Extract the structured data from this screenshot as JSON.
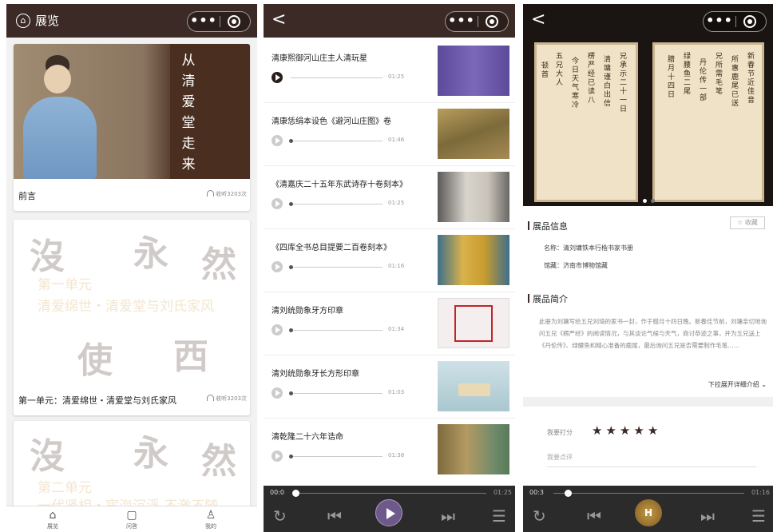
{
  "panel1": {
    "title": "展览",
    "home_icon": "⌂",
    "intro": {
      "poem": [
        "从",
        "清",
        "爱",
        "堂",
        "走",
        "来"
      ],
      "title": "前言",
      "plays": "收听3203次"
    },
    "unit1": {
      "line1": "第一单元",
      "line2": "清爱绵世・清爱堂与刘氏家风",
      "title": "第一单元：清爱绵世・清爱堂与刘氏家风",
      "plays": "收听3203次"
    },
    "unit2": {
      "line1": "第二单元",
      "line2": "一代贤相・宦海沉浮 不激不随"
    },
    "tabs": [
      {
        "icon": "⌂",
        "label": "展览"
      },
      {
        "icon": "▢",
        "label": "问答"
      },
      {
        "icon": "♙",
        "label": "我的"
      }
    ]
  },
  "panel2": {
    "back": "<",
    "items": [
      {
        "title": "清康熙御河山庄主人清玩星",
        "duration": "01:25",
        "playing": true
      },
      {
        "title": "清康恁绢本设色《避河山庄图》卷",
        "duration": "01:46",
        "playing": false
      },
      {
        "title": "《清嘉庆二十五年东武诗存十卷刻本》",
        "duration": "01:25",
        "playing": false
      },
      {
        "title": "《四库全书总目提要二百卷刻本》",
        "duration": "01:16",
        "playing": false
      },
      {
        "title": "清刘统勋象牙方印章",
        "duration": "01:34",
        "playing": false
      },
      {
        "title": "清刘统勋象牙长方形印章",
        "duration": "01:03",
        "playing": false
      },
      {
        "title": "清乾隆二十六年诰命",
        "duration": "01:38",
        "playing": false
      }
    ],
    "player": {
      "current": "00:0",
      "total": "01:25"
    }
  },
  "panel3": {
    "back": "<",
    "info_title": "展品信息",
    "collect_label": "收藏",
    "name_line": "名称：清刘墉铁本行楷书家书册",
    "museum_line": "馆藏：济南市博物馆藏",
    "intro_title": "展品简介",
    "description": "此册为刘墉写给五兄刘琦的家书一封，作于腊月十四日晚。新春佳节前，刘墉亲切地询问五兄《楞严经》的阅读情况，与其谈论气候与天气，商讨恭迹之事，并为五兄送上《丹伦传》、绿腰鱼和精心准备的鹿尾，最后询问五兄是否需要制作毛笔……",
    "expand_label": "下拉展开详细介绍",
    "rating_label": "我要打分",
    "stars": 5,
    "comment_placeholder": "我要点评",
    "player": {
      "current": "00:3",
      "total": "01:16",
      "cover_letter": "H"
    }
  }
}
